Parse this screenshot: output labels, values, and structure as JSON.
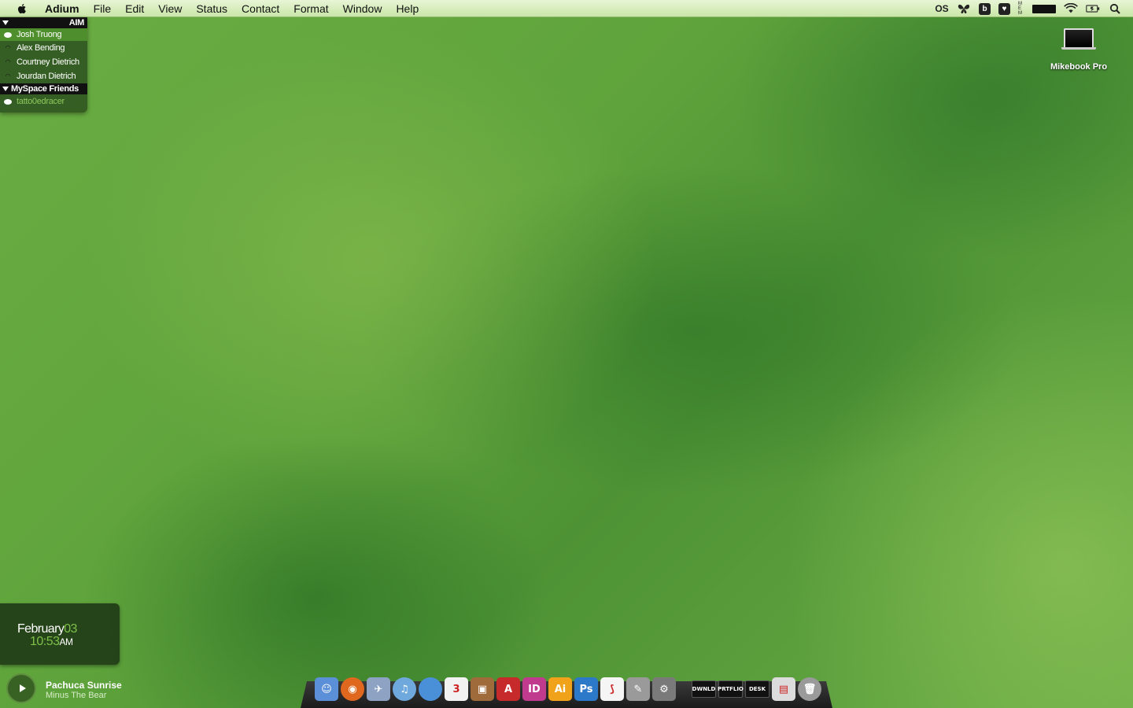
{
  "menubar": {
    "app_name": "Adium",
    "items": [
      "File",
      "Edit",
      "View",
      "Status",
      "Contact",
      "Format",
      "Window",
      "Help"
    ],
    "tray": {
      "lastfm": "OS",
      "box_b": "b",
      "stack": [
        "M",
        "E",
        "M"
      ]
    }
  },
  "buddy_list": {
    "groups": [
      {
        "name": "AIM",
        "buddies": [
          {
            "name": "Josh Truong",
            "status": "available",
            "selected": true
          },
          {
            "name": "Alex Bending",
            "status": "mobile"
          },
          {
            "name": "Courtney Dietrich",
            "status": "mobile"
          },
          {
            "name": "Jourdan Dietrich",
            "status": "mobile"
          }
        ]
      },
      {
        "name": "MySpace Friends",
        "buddies": [
          {
            "name": "tatto0edracer",
            "status": "idle"
          }
        ]
      }
    ]
  },
  "desktop": {
    "drive_label": "Mikebook Pro"
  },
  "clock": {
    "month": "February",
    "day": "03",
    "time": "10:53",
    "ampm": "AM"
  },
  "now_playing": {
    "title": "Pachuca Sunrise",
    "artist": "Minus The Bear"
  },
  "dock": {
    "apps": [
      {
        "name": "finder",
        "label": "☺",
        "bg": "#5b8fd8"
      },
      {
        "name": "firefox",
        "label": "◉",
        "bg": "#e0681e"
      },
      {
        "name": "mail",
        "label": "✈",
        "bg": "#8ea3c4"
      },
      {
        "name": "itunes",
        "label": "♫",
        "bg": "#6fa8dc"
      },
      {
        "name": "ichat",
        "label": "",
        "bg": "#4a90d9"
      },
      {
        "name": "ical",
        "label": "3",
        "bg": "#f2f2f2"
      },
      {
        "name": "iphoto",
        "label": "▣",
        "bg": "#a06b3a"
      },
      {
        "name": "adobe",
        "label": "A",
        "bg": "#c62a2a"
      },
      {
        "name": "indesign",
        "label": "ID",
        "bg": "#c03a8e"
      },
      {
        "name": "illustrator",
        "label": "Ai",
        "bg": "#f0a21b"
      },
      {
        "name": "photoshop",
        "label": "Ps",
        "bg": "#2d79c9"
      },
      {
        "name": "acrobat",
        "label": "⟆",
        "bg": "#f5f5f5"
      },
      {
        "name": "adium",
        "label": "✎",
        "bg": "#9a9a9a"
      },
      {
        "name": "system-preferences",
        "label": "⚙",
        "bg": "#7a7a7a"
      }
    ],
    "stacks": [
      "DWNLD",
      "PRTFLIO",
      "DESK"
    ],
    "extras": [
      {
        "name": "preview",
        "label": "▤",
        "bg": "#dcdcdc"
      },
      {
        "name": "trash",
        "label": "🗑",
        "bg": "#9a9a9a"
      }
    ]
  }
}
